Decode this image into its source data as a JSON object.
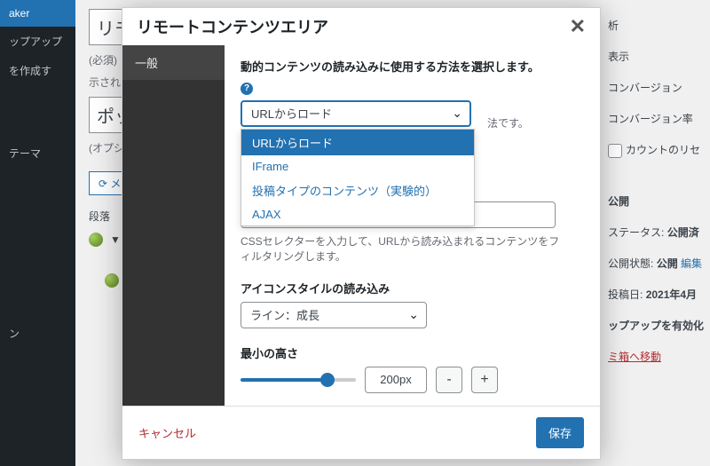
{
  "bg": {
    "sidebar_items": [
      "aker",
      "ップアップ",
      "を作成す",
      "-",
      "テーマ",
      "ン"
    ],
    "title_input": "リモ",
    "req_hint": "(必須) こ",
    "shown_hint": "示されま",
    "second_input": "ポッ",
    "opt_hint": "(オプシ",
    "meta_btn": "メ",
    "paragraph_label": "段落"
  },
  "right": {
    "item1": "析",
    "item2": "表示",
    "item3": "コンバージョン",
    "item4": "コンバージョン率",
    "item5": "カウントのリセ",
    "item6": "公開",
    "status_label": "ステータス:",
    "status_value": "公開済",
    "visibility_label": "公開状態:",
    "visibility_value": "公開",
    "edit_link": "編集",
    "date_label": "投稿日:",
    "date_value": "2021年4月",
    "enable_popup": "ップアップを有効化",
    "trash": "ミ箱へ移動"
  },
  "modal": {
    "title": "リモートコンテンツエリア",
    "tab_general": "一般",
    "method_label": "動的コンテンツの読み込みに使用する方法を選択します。",
    "method_selected": "URLからロード",
    "method_options": [
      "URLからロード",
      "IFrame",
      "投稿タイプのコンテンツ（実験的）",
      "AJAX"
    ],
    "method_desc_suffix": "法です。",
    "css_desc": "CSSセレクターを入力して、URLから読み込まれるコンテンツをフィルタリングします。",
    "icon_style_label": "アイコンスタイルの読み込み",
    "icon_style_value": "ライン：成長",
    "min_height_label": "最小の高さ",
    "min_height_value": "200px",
    "minus": "-",
    "plus": "+",
    "cancel": "キャンセル",
    "save": "保存"
  }
}
